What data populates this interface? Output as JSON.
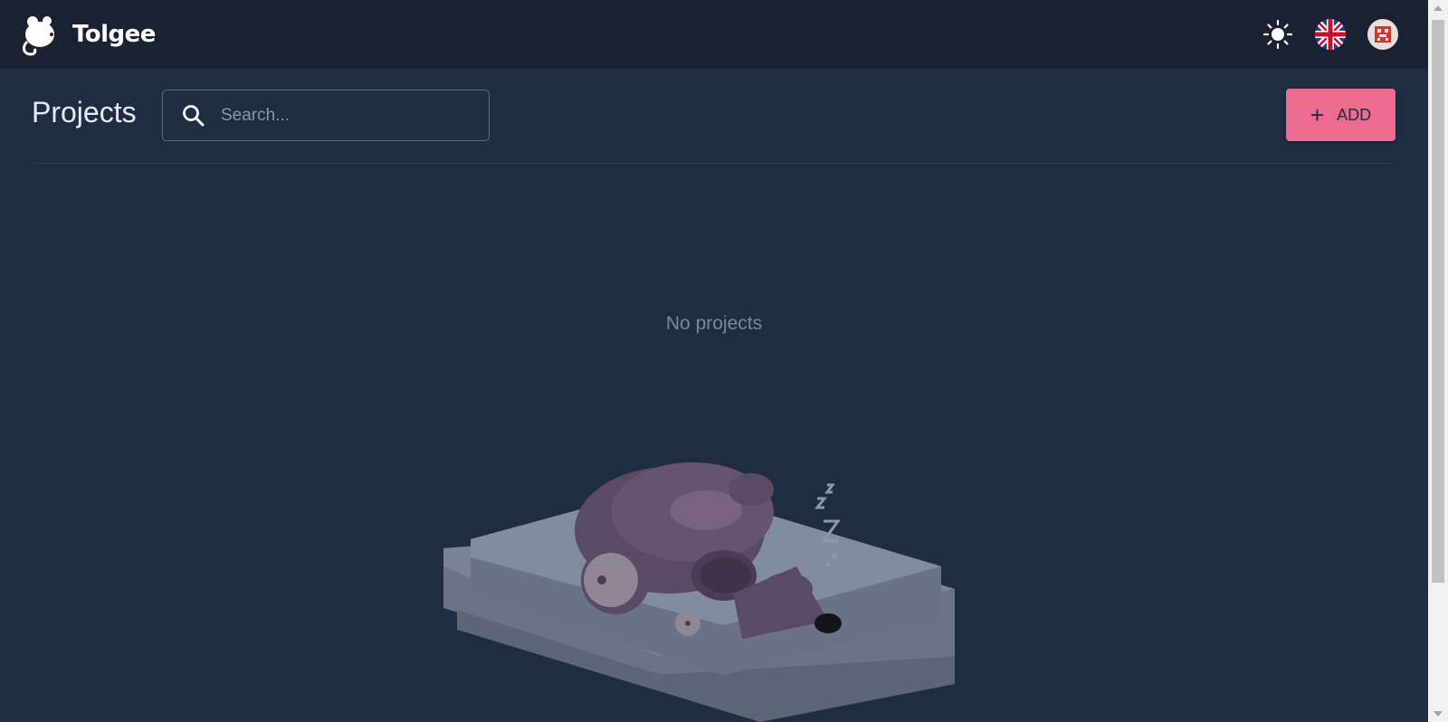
{
  "header": {
    "brand_name": "Tolgee",
    "logo_icon": "tolgee-mouse-logo",
    "actions": [
      {
        "name": "theme-toggle",
        "icon": "sun-icon"
      },
      {
        "name": "language-selector",
        "icon": "uk-flag-icon"
      },
      {
        "name": "user-menu",
        "icon": "avatar-icon"
      }
    ]
  },
  "page": {
    "title": "Projects",
    "search": {
      "placeholder": "Search...",
      "value": ""
    },
    "add_button": {
      "label": "ADD",
      "icon": "plus-icon"
    },
    "empty_state": {
      "message": "No projects",
      "illustration": "sleeping-mouse-robot"
    }
  },
  "colors": {
    "header_bg": "#1a2232",
    "page_bg": "#1f2d43",
    "accent": "#ec6b8f"
  }
}
